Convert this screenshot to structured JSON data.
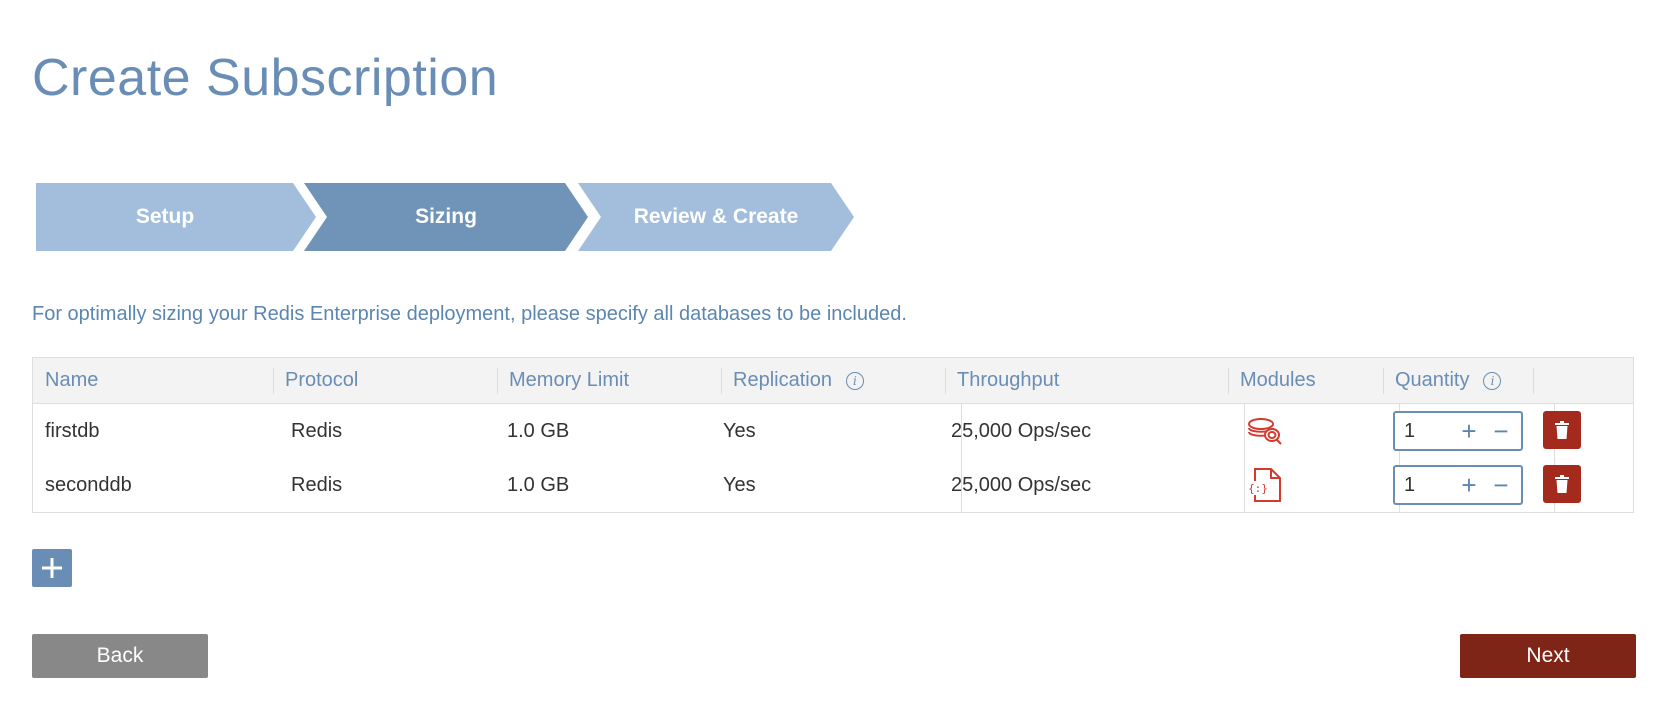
{
  "page": {
    "title": "Create Subscription"
  },
  "steps": [
    {
      "label": "Setup",
      "state": "completed"
    },
    {
      "label": "Sizing",
      "state": "active"
    },
    {
      "label": "Review & Create",
      "state": "upcoming"
    }
  ],
  "instruction": "For optimally sizing your Redis Enterprise deployment, please specify all databases to be included.",
  "table": {
    "columns": [
      "Name",
      "Protocol",
      "Memory Limit",
      "Replication",
      "Throughput",
      "Modules",
      "Quantity"
    ],
    "info_icon_glyph": "i",
    "rows": [
      {
        "name": "firstdb",
        "protocol": "Redis",
        "memory_limit": "1.0 GB",
        "replication": "Yes",
        "throughput": "25,000 Ops/sec",
        "module_icon": "redis-search-icon",
        "quantity": "1"
      },
      {
        "name": "seconddb",
        "protocol": "Redis",
        "memory_limit": "1.0 GB",
        "replication": "Yes",
        "throughput": "25,000 Ops/sec",
        "module_icon": "redis-json-icon",
        "quantity": "1"
      }
    ]
  },
  "controls": {
    "increment_glyph": "+",
    "decrement_glyph": "−"
  },
  "buttons": {
    "back": "Back",
    "next": "Next"
  },
  "colors": {
    "title": "#6a8db5",
    "step_active": "#7094b8",
    "step_inactive": "#a2bedc",
    "danger": "#a52a1e",
    "primary": "#7e2518",
    "secondary": "#888888",
    "module_icon": "#d23b2e"
  }
}
